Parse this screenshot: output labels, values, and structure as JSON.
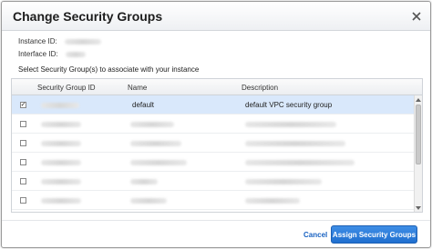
{
  "dialog": {
    "title": "Change Security Groups",
    "instance_id_label": "Instance ID:",
    "interface_id_label": "Interface ID:",
    "instruction": "Select Security Group(s) to associate with your instance"
  },
  "table": {
    "columns": [
      "Security Group ID",
      "Name",
      "Description"
    ],
    "rows": [
      {
        "checked": true,
        "name": "default",
        "description": "default VPC security group"
      },
      {
        "checked": false
      },
      {
        "checked": false
      },
      {
        "checked": false
      },
      {
        "checked": false
      },
      {
        "checked": false
      }
    ]
  },
  "footer": {
    "cancel_label": "Cancel",
    "assign_label": "Assign Security Groups"
  },
  "colors": {
    "accent": "#1f6fcf",
    "selected_row": "#d9e8fb",
    "link": "#1a63c2"
  },
  "icons": {
    "close": "close-icon",
    "check": "check-icon",
    "scroll_up": "chevron-up-icon",
    "scroll_down": "chevron-down-icon"
  }
}
